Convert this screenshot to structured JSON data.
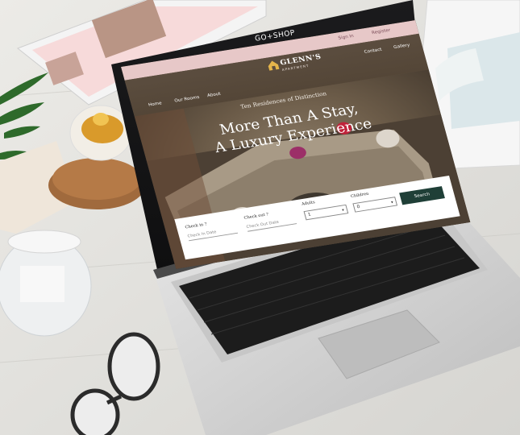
{
  "screen": {
    "top_strip": {
      "sign_in": "Sign In",
      "register": "Register"
    },
    "brand": {
      "logo_text": "GLENN'S",
      "logo_sub": "APARTMENT"
    },
    "nav": {
      "home": "Home",
      "rooms": "Our Rooms",
      "about": "About",
      "contact": "Contact",
      "gallery": "Gallery"
    },
    "hero": {
      "tagline": "Ten Residences of Distinction",
      "headline_1": "More Than A Stay,",
      "headline_2": "A Luxury Experience"
    },
    "booking": {
      "checkin_label": "Check in ?",
      "checkin_placeholder": "Check In Date",
      "checkout_label": "Check out ?",
      "checkout_placeholder": "Check Out Date",
      "adults_label": "Adults",
      "adults_value": "1",
      "children_label": "Children",
      "children_value": "0",
      "search_label": "Search"
    }
  },
  "watermark": "GO+SHOP",
  "colors": {
    "accent_pink": "#e7c8c8",
    "search_button": "#1f3f37",
    "laptop_silver": "#d9d9d9"
  }
}
